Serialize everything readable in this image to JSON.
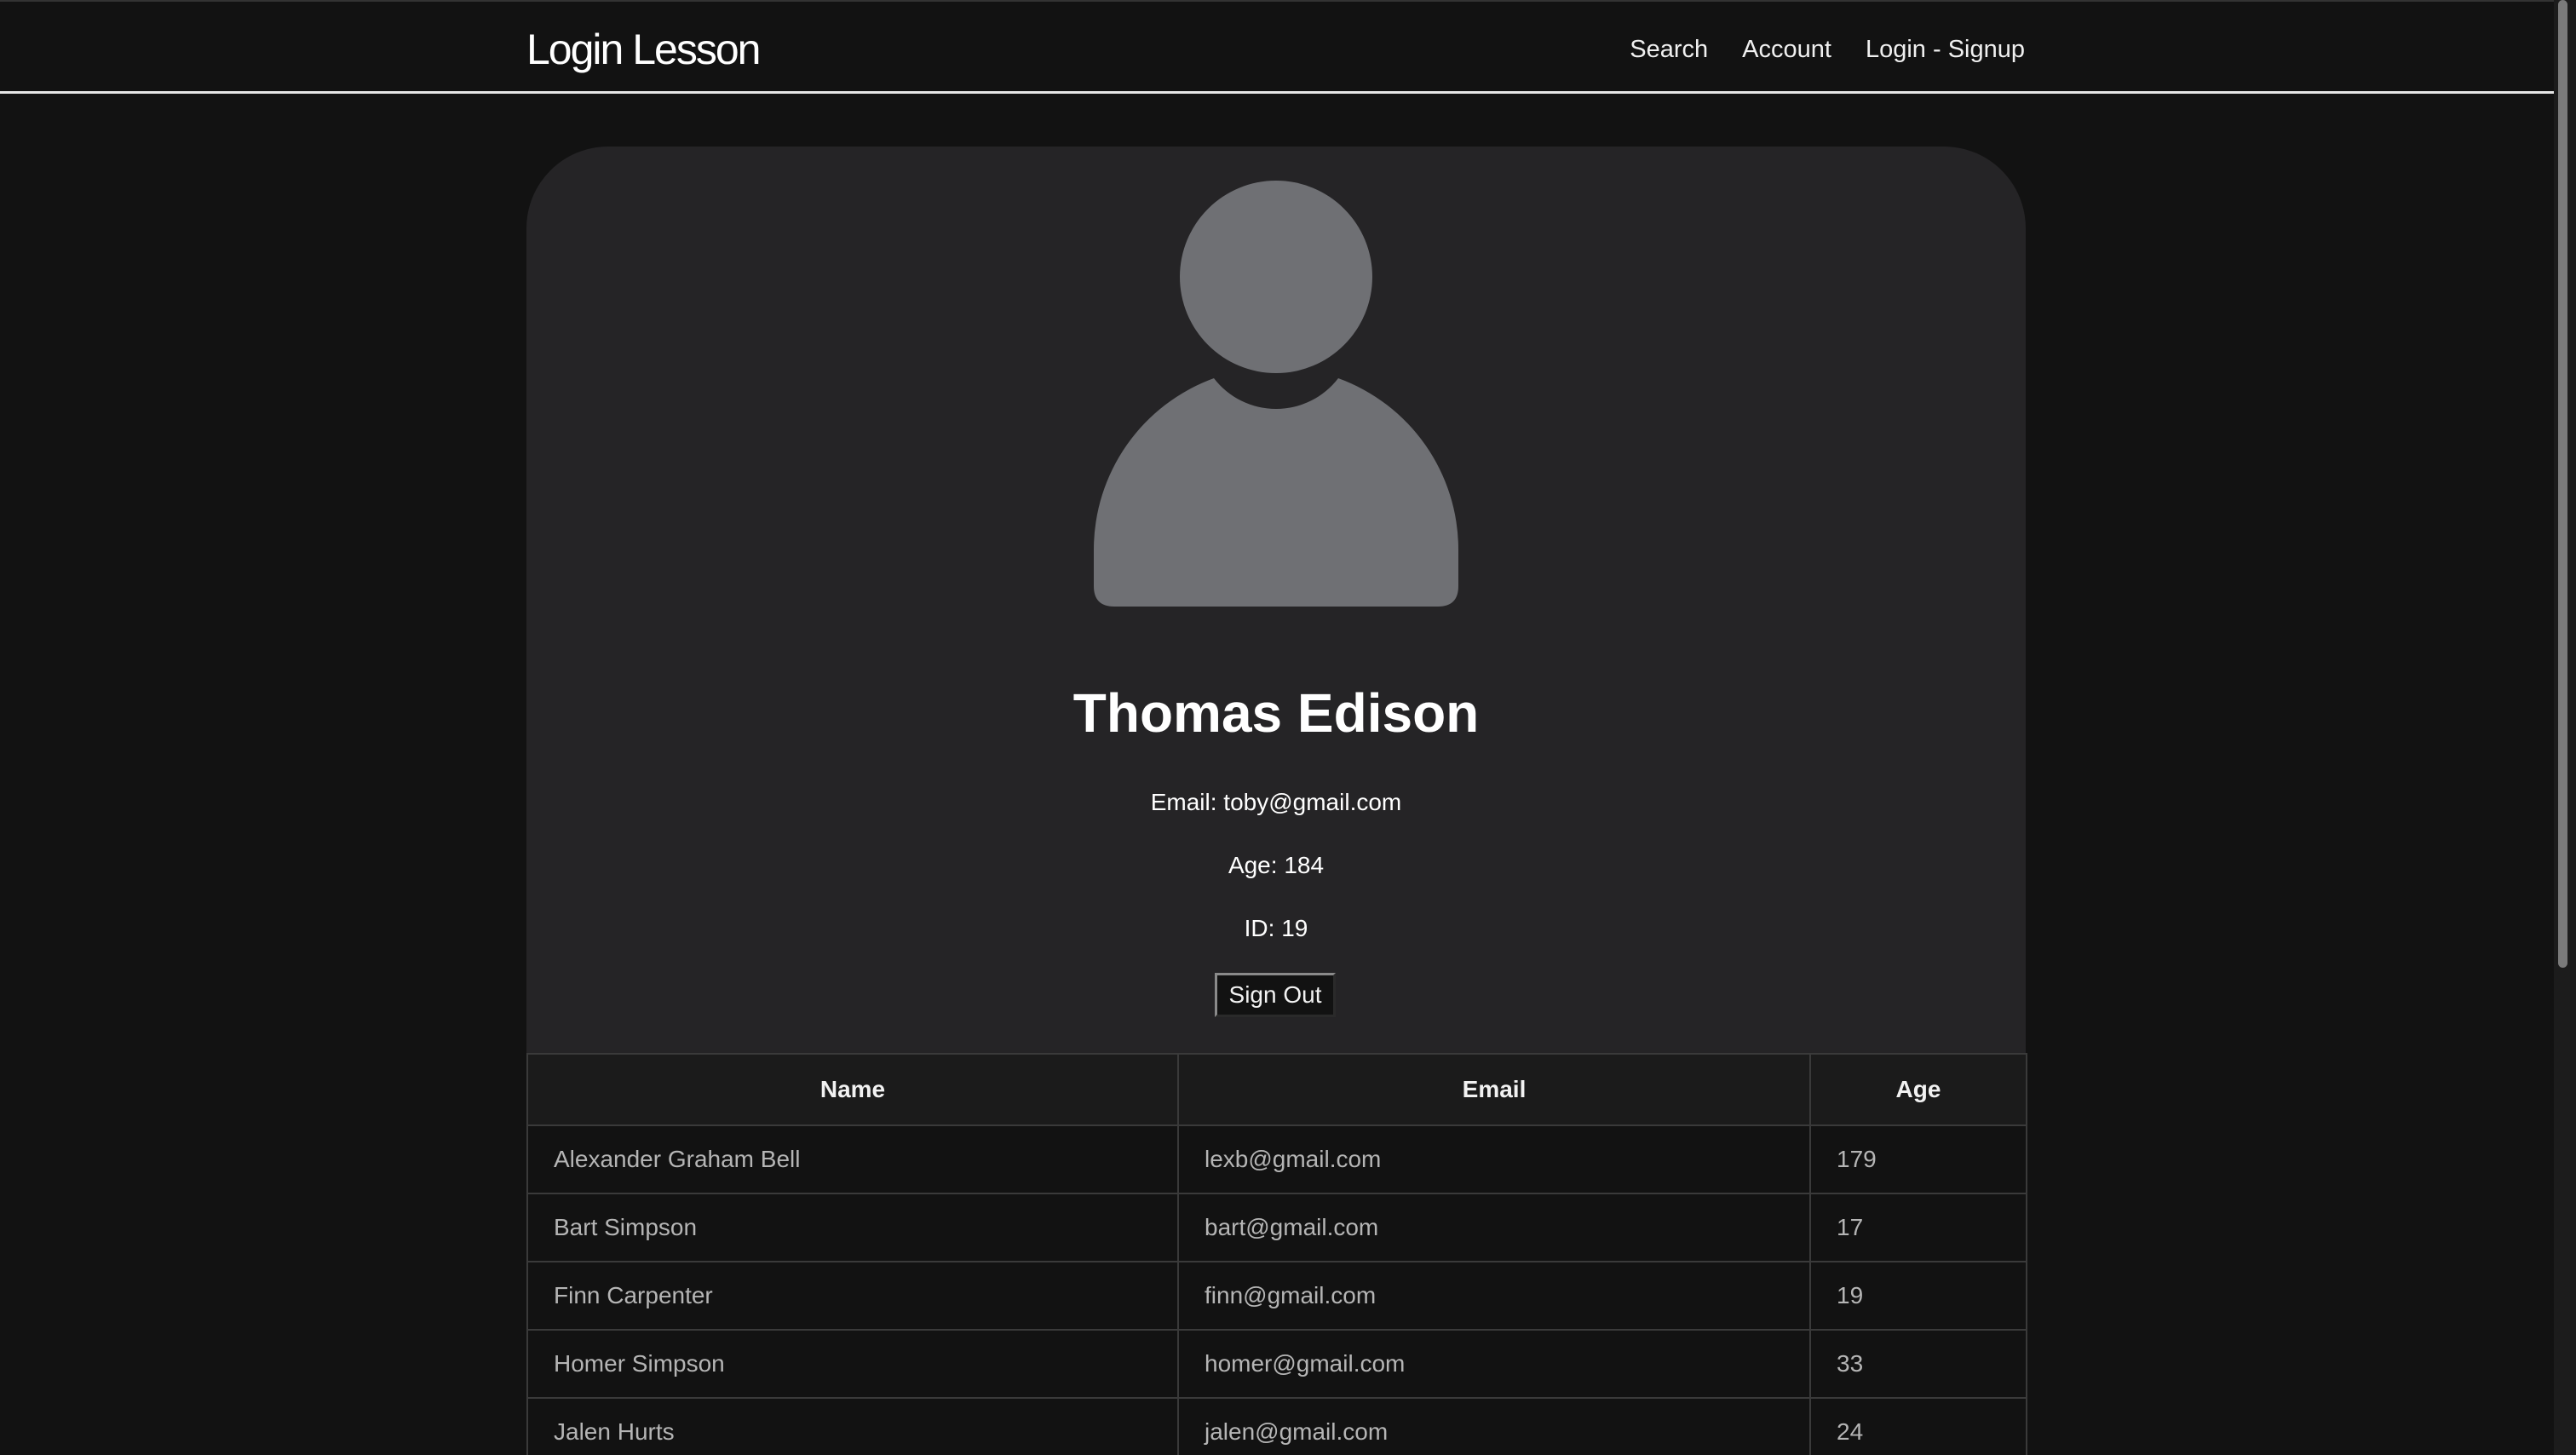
{
  "navbar": {
    "brand": "Login Lesson",
    "links": [
      "Search",
      "Account",
      "Login - Signup"
    ]
  },
  "profile": {
    "name": "Thomas Edison",
    "email_line": "Email: toby@gmail.com",
    "age_line": "Age: 184",
    "id_line": "ID: 19",
    "signout_label": "Sign Out",
    "avatar_icon": "user-silhouette-icon"
  },
  "table": {
    "headers": [
      "Name",
      "Email",
      "Age"
    ],
    "rows": [
      [
        "Alexander Graham Bell",
        "lexb@gmail.com",
        "179"
      ],
      [
        "Bart Simpson",
        "bart@gmail.com",
        "17"
      ],
      [
        "Finn Carpenter",
        "finn@gmail.com",
        "19"
      ],
      [
        "Homer Simpson",
        "homer@gmail.com",
        "33"
      ],
      [
        "Jalen Hurts",
        "jalen@gmail.com",
        "24"
      ]
    ]
  },
  "colors": {
    "background": "#121212",
    "card": "#252426",
    "avatar": "#6f7074",
    "text": "#ffffff",
    "table_text": "#b5b5b5"
  }
}
